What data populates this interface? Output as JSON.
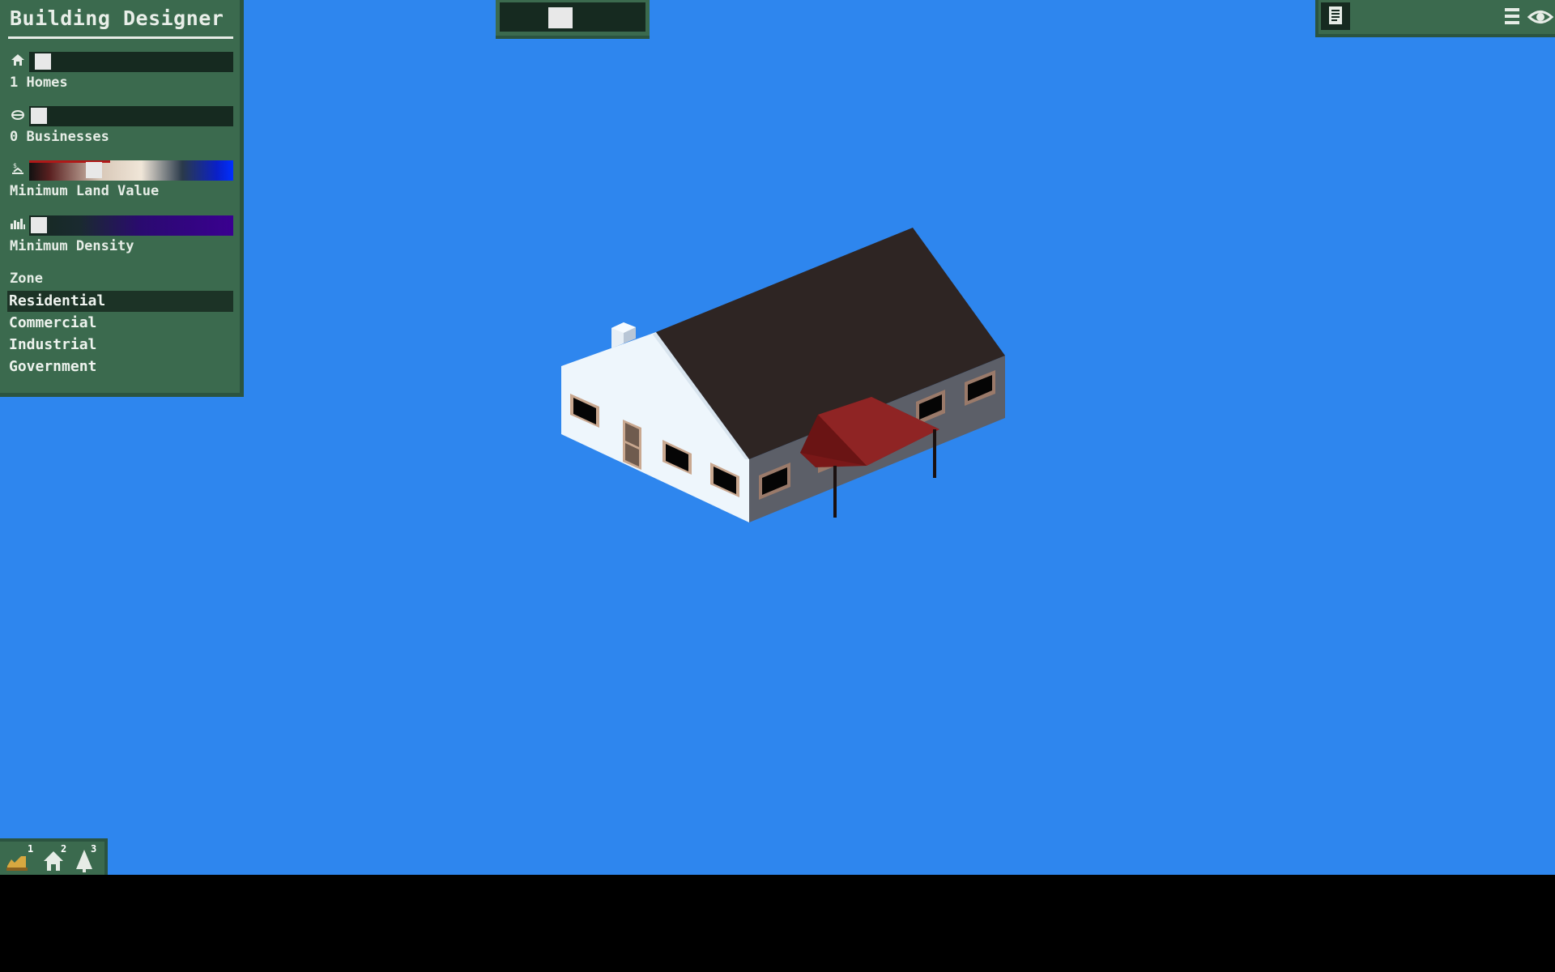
{
  "app": {
    "title": "Building Designer"
  },
  "panel": {
    "homes_label": "1 Homes",
    "businesses_label": "0 Businesses",
    "land_value_label": "Minimum Land Value",
    "density_label": "Minimum Density",
    "zone_header": "Zone",
    "zones": [
      {
        "label": "Residential",
        "selected": true
      },
      {
        "label": "Commercial",
        "selected": false
      },
      {
        "label": "Industrial",
        "selected": false
      },
      {
        "label": "Government",
        "selected": false
      }
    ],
    "homes_slider_value": 0.0,
    "businesses_slider_value": 0.0,
    "land_value_slider_value": 0.32,
    "density_slider_value": 0.0
  },
  "toolbar": {
    "tools": [
      {
        "icon": "bulldozer-icon",
        "key": "1"
      },
      {
        "icon": "house-icon",
        "key": "2"
      },
      {
        "icon": "tree-icon",
        "key": "3"
      }
    ]
  },
  "colors": {
    "sky": "#2e86ee",
    "panel": "#3b6a4e",
    "panel_dark": "#162a20",
    "roof": "#2e2523",
    "awning": "#8a1e1e",
    "wall_light": "#eef6fc",
    "wall_shade": "#5a5d66"
  }
}
